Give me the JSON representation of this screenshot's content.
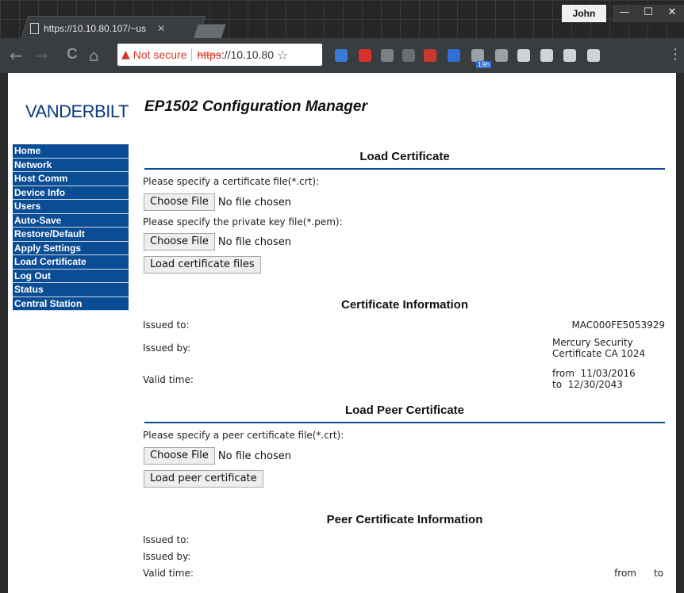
{
  "browser": {
    "tab_title": "https://10.10.80.107/~us",
    "tab_close": "✕",
    "user_name": "John",
    "window_buttons": [
      "—",
      "☐",
      "✕"
    ],
    "nav": {
      "back": "←",
      "forward": "→",
      "reload": "C",
      "home": "⌂"
    },
    "omnibox": {
      "security_label": "Not secure",
      "url_scheme": "https",
      "url_rest": "://10.10.80",
      "star": "☆"
    },
    "extension_colors": [
      "#3b7bd8",
      "#d9302a",
      "#7a8088",
      "#6a6f75",
      "#c9382f",
      "#2f6fd6",
      "#9aa0a6",
      "#9aa0a6",
      "#cfd3d6",
      "#cfd3d6",
      "#cfd3d6",
      "#cfd3d6"
    ],
    "extension_badge": "19h"
  },
  "page": {
    "logo": "VANDERBILT",
    "title": "EP1502 Configuration Manager",
    "sidebar": [
      "Home",
      "Network",
      "Host Comm",
      "Device Info",
      "Users",
      "Auto-Save",
      "Restore/Default",
      "Apply Settings",
      "Load Certificate",
      "Log Out",
      "Status",
      "Central Station"
    ],
    "load_certificate": {
      "heading": "Load Certificate",
      "cert_prompt": "Please specify a certificate file(*.crt):",
      "choose_file": "Choose File",
      "no_file": "No file chosen",
      "key_prompt": "Please specify the private key file(*.pem):",
      "load_button": "Load certificate files"
    },
    "certificate_info": {
      "heading": "Certificate Information",
      "issued_to_label": "Issued to:",
      "issued_to_value": "MAC000FE5053929",
      "issued_by_label": "Issued by:",
      "issued_by_value_1": "Mercury Security",
      "issued_by_value_2": "Certificate CA 1024",
      "valid_time_label": "Valid time:",
      "valid_from": "from  11/03/2016",
      "valid_to": "to  12/30/2043"
    },
    "load_peer": {
      "heading": "Load Peer Certificate",
      "prompt": "Please specify a peer certificate file(*.crt):",
      "choose_file": "Choose File",
      "no_file": "No file chosen",
      "load_button": "Load peer certificate"
    },
    "peer_info": {
      "heading": "Peer Certificate Information",
      "issued_to_label": "Issued to:",
      "issued_by_label": "Issued by:",
      "valid_time_label": "Valid time:",
      "valid_from": "from",
      "valid_to": "to"
    }
  },
  "colors": {
    "sidebar_bg": "#0b4d94",
    "logo": "#0b3a80",
    "warning": "#d13a2f"
  }
}
